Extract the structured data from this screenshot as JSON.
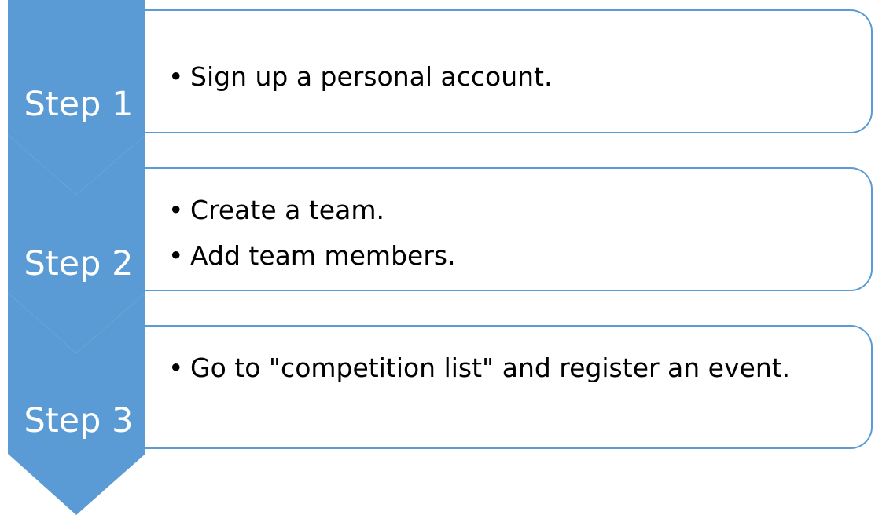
{
  "colors": {
    "chevron": "#5b9bd5",
    "box_border": "#5b9bd5",
    "label_text": "#ffffff",
    "bullet_text": "#000000"
  },
  "bullet_glyph": "•",
  "steps": [
    {
      "label": "Step 1",
      "bullets": [
        "Sign up a personal account."
      ]
    },
    {
      "label": "Step 2",
      "bullets": [
        "Create a team.",
        "Add  team members."
      ]
    },
    {
      "label": "Step 3",
      "bullets": [
        "Go to \"competition list\" and register an event."
      ]
    }
  ]
}
